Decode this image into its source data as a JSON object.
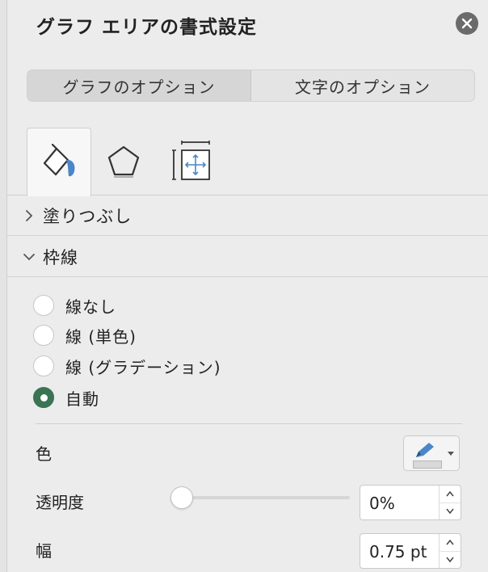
{
  "panel": {
    "title": "グラフ エリアの書式設定"
  },
  "tabs": [
    {
      "label": "グラフのオプション",
      "active": true
    },
    {
      "label": "文字のオプション",
      "active": false
    }
  ],
  "icon_tabs": [
    {
      "icon": "fill-line-icon",
      "active": true
    },
    {
      "icon": "effects-pentagon-icon",
      "active": false
    },
    {
      "icon": "size-properties-icon",
      "active": false
    }
  ],
  "sections": {
    "fill": {
      "label": "塗りつぶし",
      "expanded": false
    },
    "border": {
      "label": "枠線",
      "expanded": true
    }
  },
  "border_options": [
    {
      "label": "線なし",
      "selected": false
    },
    {
      "label": "線 (単色)",
      "selected": false
    },
    {
      "label": "線 (グラデーション)",
      "selected": false
    },
    {
      "label": "自動",
      "selected": true
    }
  ],
  "properties": {
    "color_label": "色",
    "transparency_label": "透明度",
    "transparency_value": "0%",
    "transparency_fraction": 0,
    "width_label": "幅",
    "width_value": "0.75 pt"
  },
  "colors": {
    "accent_radio": "#3a7452",
    "pen_icon": "#4a86c8"
  }
}
